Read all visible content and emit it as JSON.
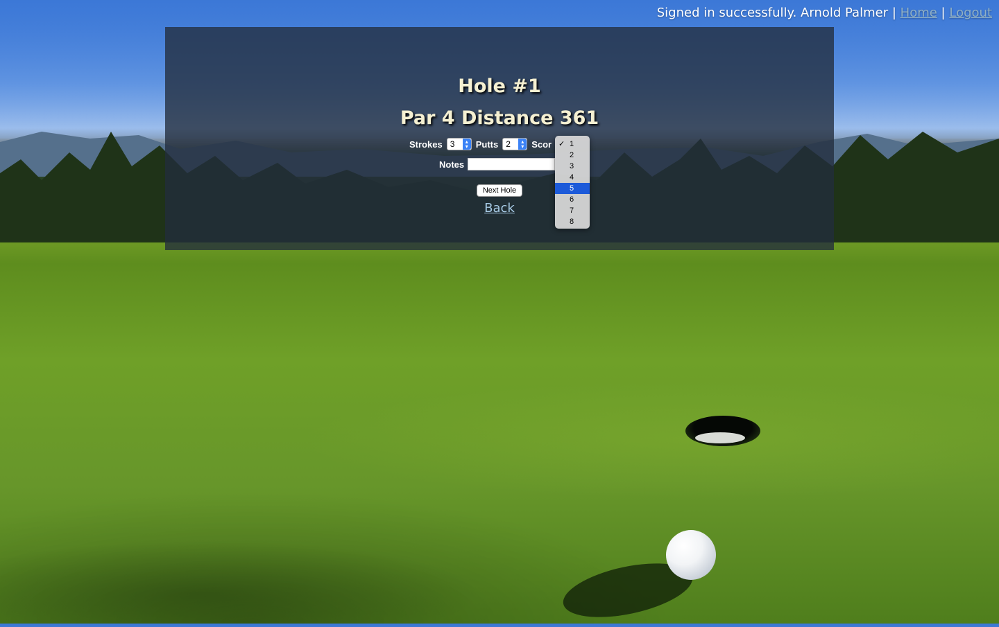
{
  "header": {
    "status_text": "Signed in successfully. Arnold Palmer",
    "separator": "|",
    "home_link": "Home",
    "logout_link": "Logout"
  },
  "hole": {
    "title": "Hole #1",
    "par_distance": "Par 4 Distance 361"
  },
  "form": {
    "strokes_label": "Strokes",
    "strokes_value": "3",
    "putts_label": "Putts",
    "putts_value": "2",
    "score_label": "Scor",
    "notes_label": "Notes",
    "notes_value": "",
    "next_button": "Next Hole",
    "back_link": "Back"
  },
  "score_dropdown": {
    "checkmark": "✓",
    "checked_option": "1",
    "highlighted_option": "5",
    "options": [
      "1",
      "2",
      "3",
      "4",
      "5",
      "6",
      "7",
      "8"
    ]
  },
  "colors": {
    "highlight": "#1c5ad9",
    "title_text": "#f5f0d2",
    "link": "#8fb0c6"
  }
}
